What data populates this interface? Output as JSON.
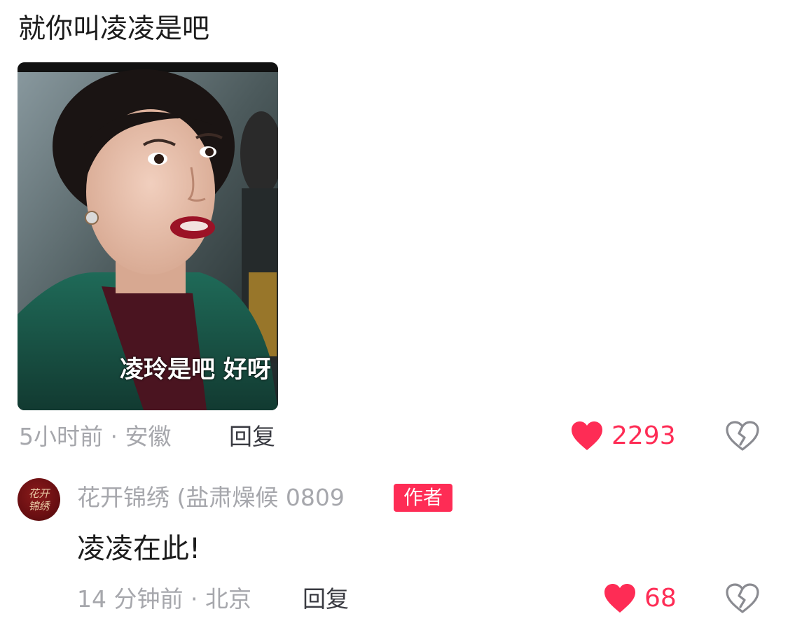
{
  "comment": {
    "text": "就你叫凌凌是吧",
    "media": {
      "subtitle": "凌玲是吧 好呀"
    },
    "meta": "5小时前 · 安徽",
    "reply_label": "回复",
    "likes": "2293"
  },
  "reply_comment": {
    "username": "花开锦绣 (盐肃燥候 0809",
    "author_badge": "作者",
    "avatar_text": "花开锦绣",
    "text": "凌凌在此!",
    "meta": "14 分钟前 · 北京",
    "reply_label": "回复",
    "likes": "68"
  },
  "colors": {
    "like_red": "#fe2c55",
    "meta_gray": "#a6a7ac"
  },
  "icons": {
    "like": "heart-filled-icon",
    "dislike": "broken-heart-icon"
  }
}
